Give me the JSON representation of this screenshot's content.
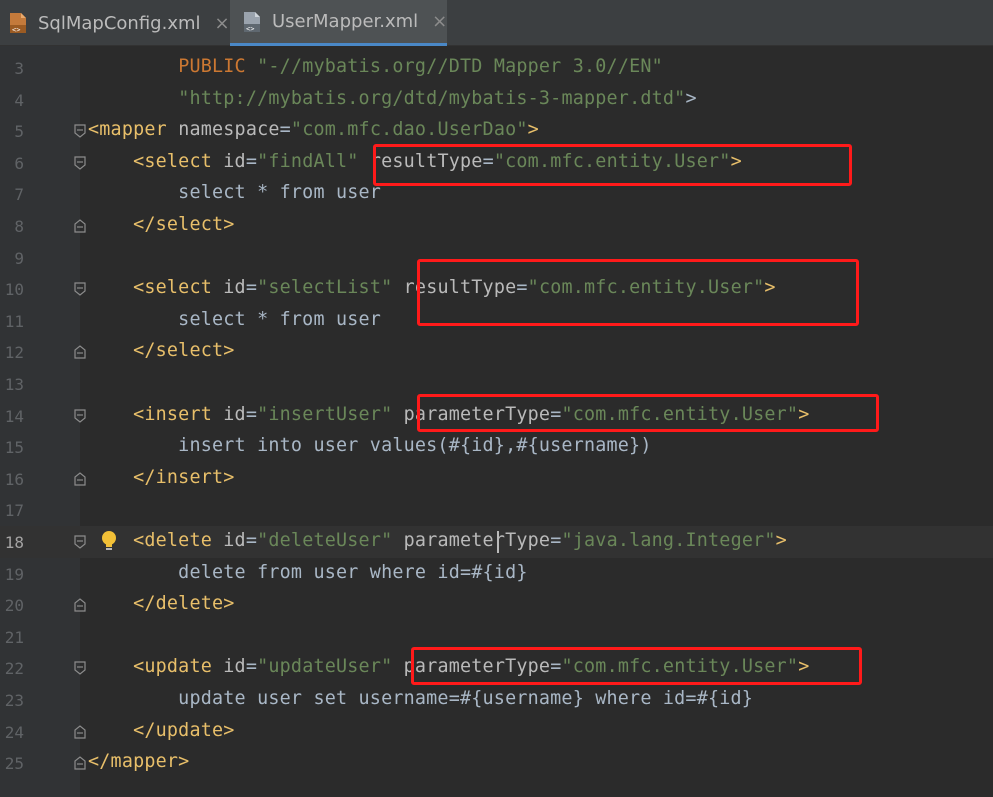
{
  "tabs": [
    {
      "label": "SqlMapConfig.xml",
      "active": false,
      "close": "×"
    },
    {
      "label": "UserMapper.xml",
      "active": true,
      "close": "×"
    }
  ],
  "lines": [
    {
      "n": "3",
      "segs": [
        [
          "p",
          "        "
        ],
        [
          "k",
          "PUBLIC"
        ],
        [
          "p",
          " "
        ],
        [
          "v",
          "\"-//mybatis.org//DTD Mapper 3.0//EN\""
        ]
      ]
    },
    {
      "n": "4",
      "segs": [
        [
          "p",
          "        "
        ],
        [
          "v",
          "\"http://mybatis.org/dtd/mybatis-3-mapper.dtd\""
        ],
        [
          "p",
          ">"
        ]
      ]
    },
    {
      "n": "5",
      "segs": [
        [
          "t",
          "<mapper"
        ],
        [
          "p",
          " "
        ],
        [
          "a",
          "namespace"
        ],
        [
          "p",
          "="
        ],
        [
          "v",
          "\"com.mfc.dao.UserDao\""
        ],
        [
          "t",
          ">"
        ]
      ]
    },
    {
      "n": "6",
      "segs": [
        [
          "p",
          "    "
        ],
        [
          "t",
          "<select"
        ],
        [
          "p",
          " "
        ],
        [
          "a",
          "id"
        ],
        [
          "p",
          "="
        ],
        [
          "v",
          "\"findAll\""
        ],
        [
          "p",
          " "
        ],
        [
          "a",
          "resultType"
        ],
        [
          "p",
          "="
        ],
        [
          "v",
          "\"com.mfc.entity.User\""
        ],
        [
          "t",
          ">"
        ]
      ]
    },
    {
      "n": "7",
      "segs": [
        [
          "p",
          "        select * from user"
        ]
      ]
    },
    {
      "n": "8",
      "segs": [
        [
          "p",
          "    "
        ],
        [
          "t",
          "</select>"
        ]
      ]
    },
    {
      "n": "9",
      "segs": []
    },
    {
      "n": "10",
      "segs": [
        [
          "p",
          "    "
        ],
        [
          "t",
          "<select"
        ],
        [
          "p",
          " "
        ],
        [
          "a",
          "id"
        ],
        [
          "p",
          "="
        ],
        [
          "v",
          "\"selectList\""
        ],
        [
          "p",
          " "
        ],
        [
          "a",
          "resultType"
        ],
        [
          "p",
          "="
        ],
        [
          "v",
          "\"com.mfc.entity.User\""
        ],
        [
          "t",
          ">"
        ]
      ]
    },
    {
      "n": "11",
      "segs": [
        [
          "p",
          "        select * from user"
        ]
      ]
    },
    {
      "n": "12",
      "segs": [
        [
          "p",
          "    "
        ],
        [
          "t",
          "</select>"
        ]
      ]
    },
    {
      "n": "13",
      "segs": []
    },
    {
      "n": "14",
      "segs": [
        [
          "p",
          "    "
        ],
        [
          "t",
          "<insert"
        ],
        [
          "p",
          " "
        ],
        [
          "a",
          "id"
        ],
        [
          "p",
          "="
        ],
        [
          "v",
          "\"insertUser\""
        ],
        [
          "p",
          " "
        ],
        [
          "a",
          "parameterType"
        ],
        [
          "p",
          "="
        ],
        [
          "v",
          "\"com.mfc.entity.User\""
        ],
        [
          "t",
          ">"
        ]
      ]
    },
    {
      "n": "15",
      "segs": [
        [
          "p",
          "        insert into user values(#{id},#{username})"
        ]
      ]
    },
    {
      "n": "16",
      "segs": [
        [
          "p",
          "    "
        ],
        [
          "t",
          "</insert>"
        ]
      ]
    },
    {
      "n": "17",
      "segs": []
    },
    {
      "n": "18",
      "segs": [
        [
          "p",
          "    "
        ],
        [
          "t",
          "<delete"
        ],
        [
          "p",
          " "
        ],
        [
          "a",
          "id"
        ],
        [
          "p",
          "="
        ],
        [
          "v",
          "\"deleteUser\""
        ],
        [
          "p",
          " "
        ],
        [
          "a",
          "parameterType"
        ],
        [
          "p",
          "="
        ],
        [
          "v",
          "\"java.lang.Integer\""
        ],
        [
          "t",
          ">"
        ]
      ]
    },
    {
      "n": "19",
      "segs": [
        [
          "p",
          "        delete from user where id=#{id}"
        ]
      ]
    },
    {
      "n": "20",
      "segs": [
        [
          "p",
          "    "
        ],
        [
          "t",
          "</delete>"
        ]
      ]
    },
    {
      "n": "21",
      "segs": []
    },
    {
      "n": "22",
      "segs": [
        [
          "p",
          "    "
        ],
        [
          "t",
          "<update"
        ],
        [
          "p",
          " "
        ],
        [
          "a",
          "id"
        ],
        [
          "p",
          "="
        ],
        [
          "v",
          "\"updateUser\""
        ],
        [
          "p",
          " "
        ],
        [
          "a",
          "parameterType"
        ],
        [
          "p",
          "="
        ],
        [
          "v",
          "\"com.mfc.entity.User\""
        ],
        [
          "t",
          ">"
        ]
      ]
    },
    {
      "n": "23",
      "segs": [
        [
          "p",
          "        update user set username=#{username} where id=#{id}"
        ]
      ]
    },
    {
      "n": "24",
      "segs": [
        [
          "p",
          "    "
        ],
        [
          "t",
          "</update>"
        ]
      ]
    },
    {
      "n": "25",
      "segs": [
        [
          "t",
          "</mapper>"
        ]
      ]
    }
  ],
  "current_line": "18",
  "highlight_color": "#ff1a1a",
  "icons": {
    "file": "xml-file-icon",
    "bulb": "lightbulb-icon",
    "fold": "fold-marker-icon"
  }
}
